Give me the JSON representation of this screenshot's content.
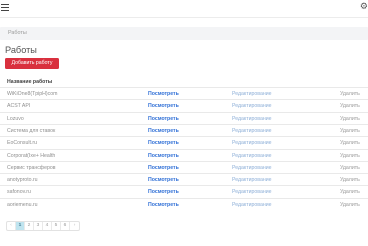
{
  "header": {
    "menu_icon": "hamburger-icon",
    "settings_icon": "gear-icon"
  },
  "breadcrumb": {
    "text": "Работы"
  },
  "page": {
    "title": "Работы",
    "add_button_label": "Добавить работу"
  },
  "table": {
    "column_header": "Название работы",
    "view_label": "Посмотреть",
    "edit_label": "Редактирование",
    "delete_label": "Удалить",
    "rows": [
      {
        "name": "WiKiOne8(TpipH)com"
      },
      {
        "name": "ACST API"
      },
      {
        "name": "Lozuvo"
      },
      {
        "name": "Система для ставок"
      },
      {
        "name": "EoConsult.ru"
      },
      {
        "name": "Corporat(Ixe+ Health"
      },
      {
        "name": "Сервис трансферов"
      },
      {
        "name": "anotyproto.ru"
      },
      {
        "name": "safonov.ru"
      },
      {
        "name": "aoriemenu.ru"
      }
    ]
  },
  "pagination": {
    "prev": "‹",
    "pages": [
      "1",
      "2",
      "3",
      "4",
      "5",
      "6"
    ],
    "active_page": "1",
    "next": "›"
  },
  "colors": {
    "accent_red": "#d9303e",
    "link_blue": "#2f6fd6",
    "pagination_active": "#bfe4ef"
  }
}
